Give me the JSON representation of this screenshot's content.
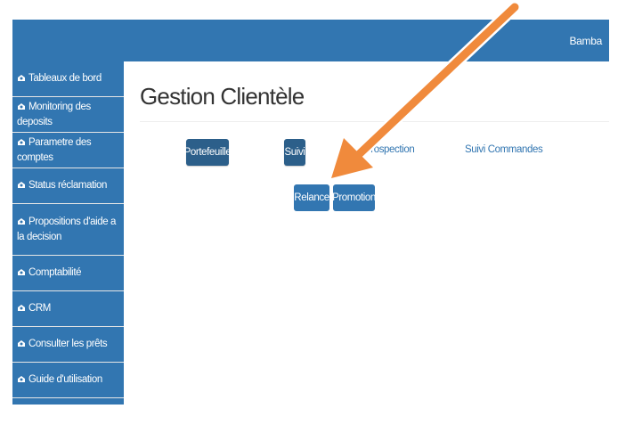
{
  "header": {
    "user_name": "Bamba"
  },
  "sidebar": {
    "items": [
      {
        "icon": "dashboard-icon",
        "label": "Tableaux de bord"
      },
      {
        "icon": "dashboard-icon",
        "label": "Monitoring des deposits"
      },
      {
        "icon": "dashboard-icon",
        "label": "Parametre des comptes"
      },
      {
        "icon": "dashboard-icon",
        "label": "Status réclamation"
      },
      {
        "icon": "dashboard-icon",
        "label": "Propositions d'aide a la decision"
      },
      {
        "icon": "dashboard-icon",
        "label": "Comptabilité"
      },
      {
        "icon": "dashboard-icon",
        "label": "CRM"
      },
      {
        "icon": "dashboard-icon",
        "label": "Consulter les prêts"
      },
      {
        "icon": "dashboard-icon",
        "label": "Guide d'utilisation"
      }
    ]
  },
  "main": {
    "title": "Gestion Clientèle",
    "tabs": [
      {
        "label": "Portefeuille",
        "style": "button"
      },
      {
        "label": "Suivi",
        "style": "button"
      },
      {
        "label": "Prospection",
        "style": "link"
      },
      {
        "label": "Suivi Commandes",
        "style": "link"
      }
    ],
    "sub_buttons": [
      {
        "label": "Relance"
      },
      {
        "label": "Promotion"
      }
    ]
  },
  "annotation": {
    "type": "arrow",
    "color": "#f08a3c"
  },
  "colors": {
    "primary": "#3276b1",
    "tab_dark": "#2c5f8a",
    "annotation_arrow": "#f08a3c"
  }
}
